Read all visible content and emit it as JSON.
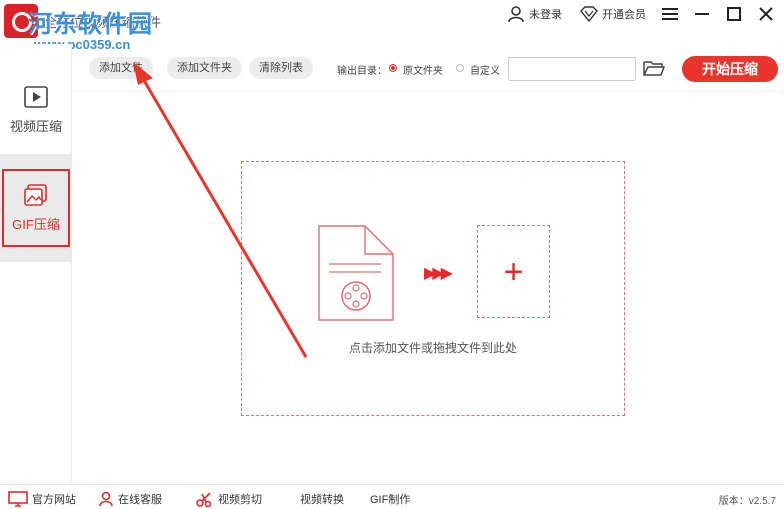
{
  "titlebar": {
    "app_title": "全方位视频压缩软件",
    "watermark_text": "河东软件园",
    "watermark_url": "www.pc0359.cn",
    "login_label": "未登录",
    "vip_label": "开通会员"
  },
  "sidebar": {
    "items": [
      {
        "label": "视频压缩",
        "icon": "play-icon"
      },
      {
        "label": "GIF压缩",
        "icon": "image-icon"
      }
    ]
  },
  "toolbar": {
    "add_file": "添加文件",
    "add_folder": "添加文件夹",
    "clear_list": "清除列表",
    "output_label": "输出目录：",
    "radio_original": "原文件夹",
    "radio_custom": "自定义",
    "selected_output": "原文件夹",
    "path_value": "",
    "start_button": "开始压缩"
  },
  "dropzone": {
    "hint": "点击添加文件或拖拽文件到此处",
    "arrows": "▶▶▶",
    "plus": "+"
  },
  "footer": {
    "items": [
      "官方网站",
      "在线客服",
      "视频剪切",
      "视频转换",
      "GIF制作"
    ],
    "version": "版本：v2.5.7"
  },
  "colors": {
    "accent": "#e8362e",
    "watermark": "#3d8fd6"
  }
}
